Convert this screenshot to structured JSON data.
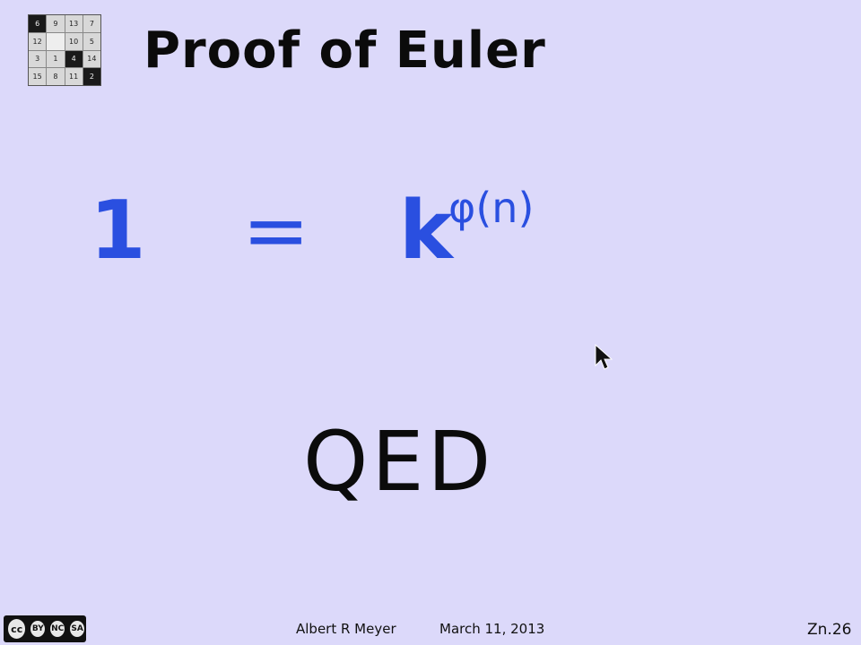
{
  "logo": {
    "tiles": [
      {
        "label": "6",
        "style": "dark"
      },
      {
        "label": "9",
        "style": "light"
      },
      {
        "label": "13",
        "style": "light"
      },
      {
        "label": "7",
        "style": "light"
      },
      {
        "label": "12",
        "style": "light"
      },
      {
        "label": "",
        "style": "empty"
      },
      {
        "label": "10",
        "style": "light"
      },
      {
        "label": "5",
        "style": "light"
      },
      {
        "label": "3",
        "style": "light"
      },
      {
        "label": "1",
        "style": "light"
      },
      {
        "label": "4",
        "style": "dark"
      },
      {
        "label": "14",
        "style": "light"
      },
      {
        "label": "15",
        "style": "light"
      },
      {
        "label": "8",
        "style": "light"
      },
      {
        "label": "11",
        "style": "light"
      },
      {
        "label": "2",
        "style": "dark"
      }
    ]
  },
  "slide": {
    "title": "Proof of Euler",
    "equation": {
      "lhs": "1",
      "sign": "=",
      "base": "k",
      "exponent": "φ(n)"
    },
    "conclusion": "QED"
  },
  "footer": {
    "license_badge": {
      "cc": "cc",
      "by": "BY",
      "nc": "NC",
      "sa": "SA"
    },
    "author": "Albert R Meyer",
    "date": "March 11, 2013",
    "page_label": "Zn.26"
  },
  "colors": {
    "background": "#dcd9fa",
    "equation": "#2a4fe0",
    "text": "#0b0b0b"
  }
}
